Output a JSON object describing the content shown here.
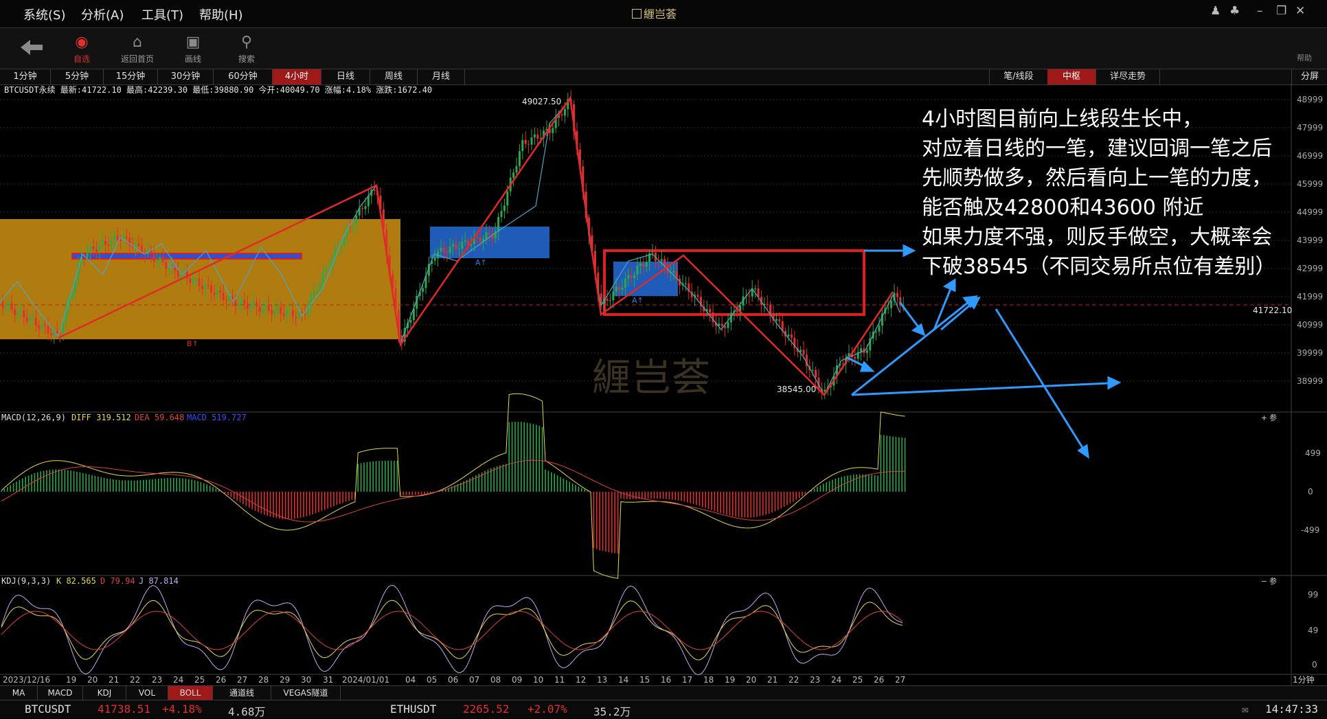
{
  "menu": {
    "items": [
      "系统(S)",
      "分析(A)",
      "工具(T)",
      "帮助(H)"
    ],
    "app_title": "緾岂荟"
  },
  "toolbar": {
    "back_label": "",
    "buttons": [
      {
        "label": "自选",
        "icon": "bar-chart-icon"
      },
      {
        "label": "返回首页",
        "icon": "home-icon"
      },
      {
        "label": "画线",
        "icon": "draw-line-icon"
      },
      {
        "label": "搜索",
        "icon": "search-icon"
      }
    ],
    "help": "帮助"
  },
  "periods": [
    "1分钟",
    "5分钟",
    "15分钟",
    "30分钟",
    "60分钟",
    "4小时",
    "日线",
    "周线",
    "月线"
  ],
  "active_period": "4小时",
  "right_tabs": [
    "笔/线段",
    "中枢",
    "详尽走势"
  ],
  "active_right_tab": "中枢",
  "split_label": "分屏",
  "info_line": "BTCUSDT永续  最新:41722.10 最高:42239.30 最低:39880.90 今开:40049.70 涨幅:4.18% 涨跌:1672.40",
  "annotation": "4小时图目前向上线段生长中，\n对应着日线的一笔，建议回调一笔之后\n先顺势做多，然后看向上一笔的力度，\n能否触及42800和43600 附近\n如果力度不强，则反手做空，大概率会\n下破38545（不同交易所点位有差别）",
  "watermark": "緾岂荟",
  "price_labels": {
    "high": "49027.50",
    "low": "38545.00",
    "last": "41722.10"
  },
  "marks": {
    "buy": "B↑",
    "pivot_a1": "A↑",
    "pivot_a2": "A↑",
    "sell": "S↓"
  },
  "price_axis": [
    "48999",
    "47999",
    "46999",
    "45999",
    "44999",
    "43999",
    "42999",
    "41999",
    "40999",
    "39999",
    "38999"
  ],
  "macd": {
    "title": "MACD(12,26,9)",
    "diff": "DIFF 319.512",
    "dea": "DEA 59.648",
    "macd": "MACD 519.727",
    "axis": [
      "499",
      "0",
      "-499"
    ],
    "param": "参"
  },
  "kdj": {
    "title": "KDJ(9,3,3)",
    "k": "K 82.565",
    "d": "D 79.94",
    "j": "J 87.814",
    "axis": [
      "99",
      "49",
      "0"
    ],
    "param": "参"
  },
  "date_axis": [
    "2023/12/16",
    "19",
    "20",
    "21",
    "22",
    "23",
    "24",
    "25",
    "26",
    "27",
    "28",
    "29",
    "30",
    "31",
    "2024/01/01",
    "04",
    "05",
    "06",
    "07",
    "08",
    "09",
    "10",
    "11",
    "12",
    "13",
    "14",
    "15",
    "16",
    "17",
    "18",
    "19",
    "20",
    "21",
    "22",
    "23",
    "24",
    "25",
    "26",
    "27"
  ],
  "period_right": "1分钟",
  "indicator_tabs": [
    "MA",
    "MACD",
    "KDJ",
    "VOL",
    "BOLL",
    "通道线",
    "VEGAS隧道"
  ],
  "active_indicator": "BOLL",
  "tickers": [
    {
      "symbol": "BTCUSDT",
      "price": "41738.51",
      "change": "+4.18%",
      "volume": "4.68万"
    },
    {
      "symbol": "ETHUSDT",
      "price": "2265.52",
      "change": "+2.07%",
      "volume": "35.2万"
    }
  ],
  "clock": "14:47:33",
  "colors": {
    "up": "#2ea84a",
    "down": "#e03030",
    "accent": "#a01818",
    "zone": "#b07c10",
    "pivot": "#1f63c8",
    "arrow": "#2f9bff"
  }
}
